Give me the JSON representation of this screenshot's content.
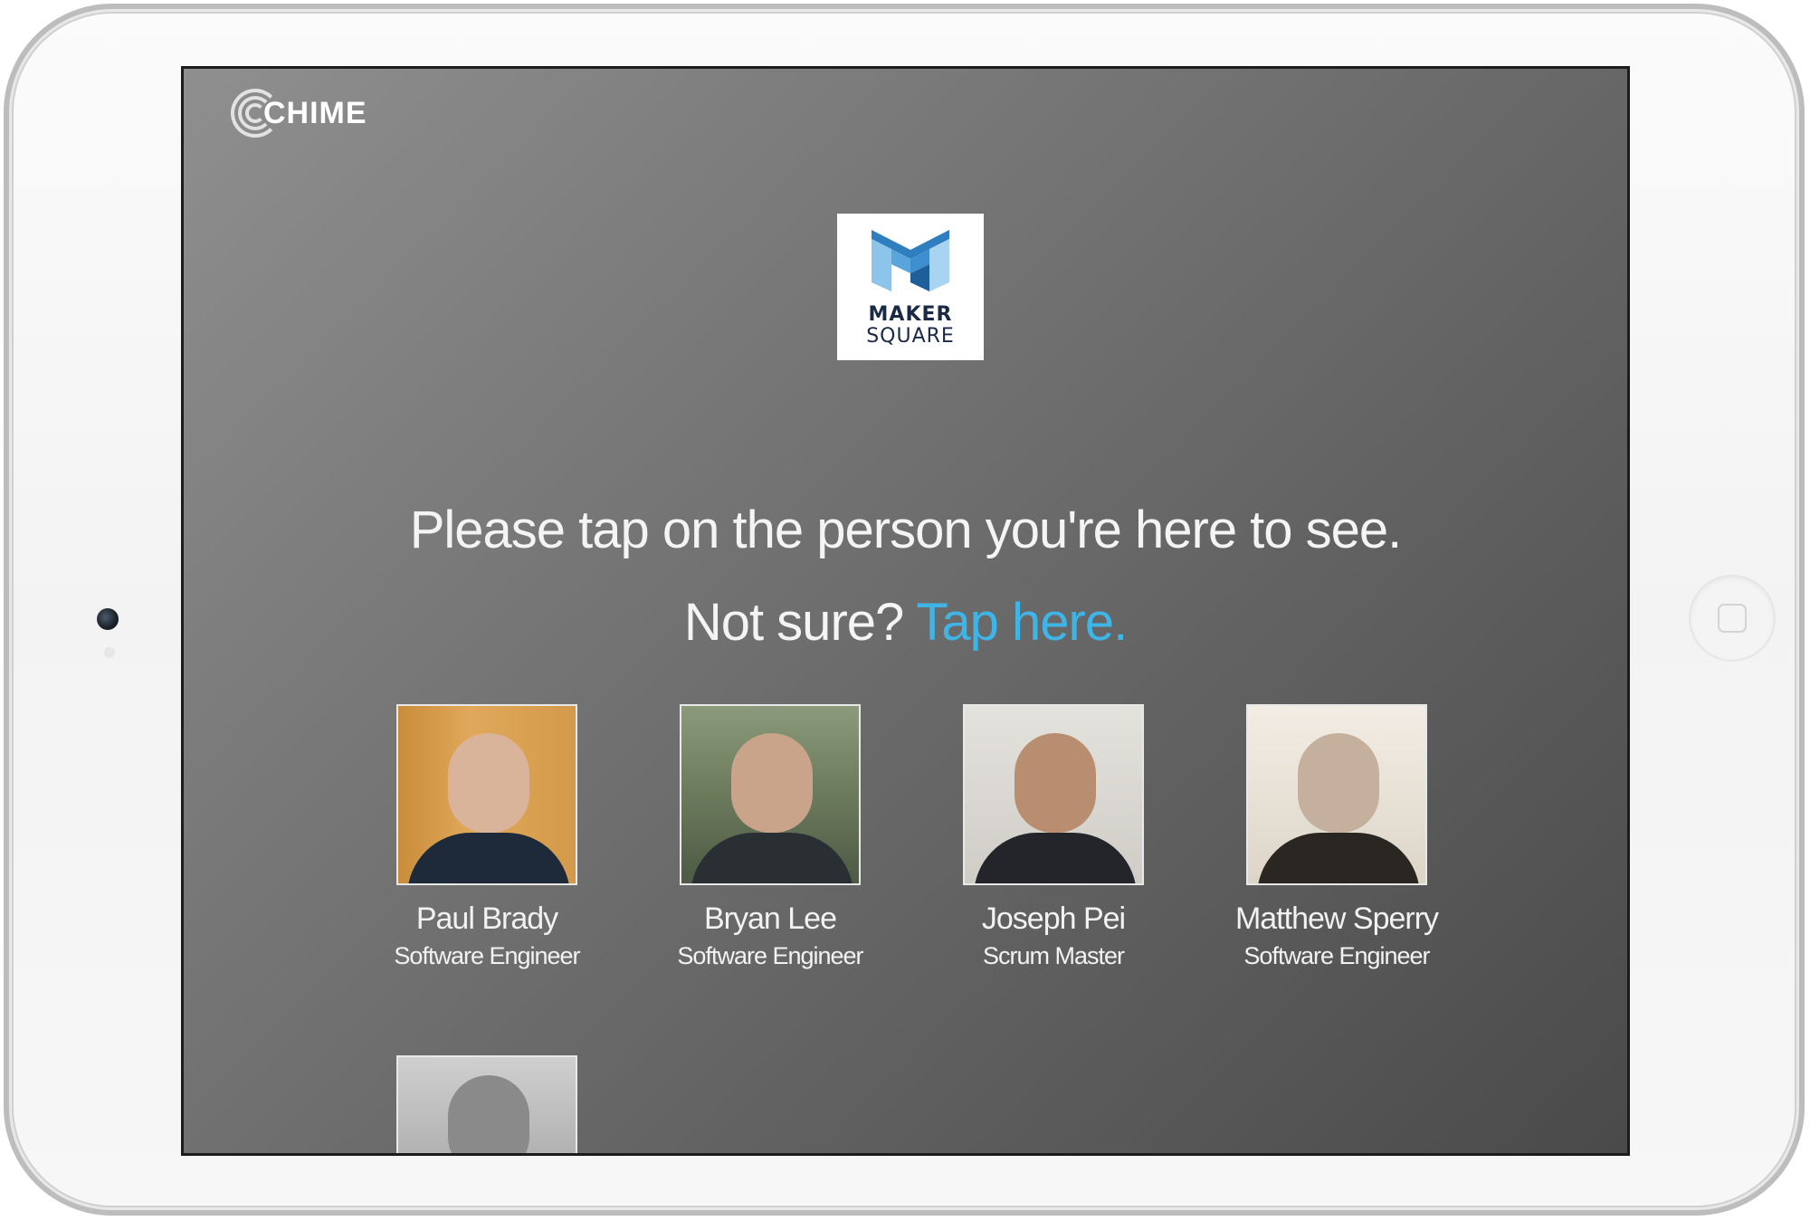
{
  "brand": {
    "name": "CHIME"
  },
  "client": {
    "name_line1": "MAKER",
    "name_line2": "SQUARE"
  },
  "prompt": {
    "main": "Please tap on the person you're here to see.",
    "not_sure": "Not sure?",
    "tap_here": "Tap here."
  },
  "people": [
    {
      "name": "Paul Brady",
      "title": "Software Engineer"
    },
    {
      "name": "Bryan Lee",
      "title": "Software Engineer"
    },
    {
      "name": "Joseph Pei",
      "title": "Scrum Master"
    },
    {
      "name": "Matthew Sperry",
      "title": "Software Engineer"
    },
    {
      "name": "",
      "title": ""
    }
  ],
  "colors": {
    "accent": "#3fb4e6",
    "screen_gradient_start": "#8f8f8f",
    "screen_gradient_end": "#4a4a4a",
    "client_logo_dark": "#1b2a44",
    "client_logo_light": "#6fb6e0"
  }
}
